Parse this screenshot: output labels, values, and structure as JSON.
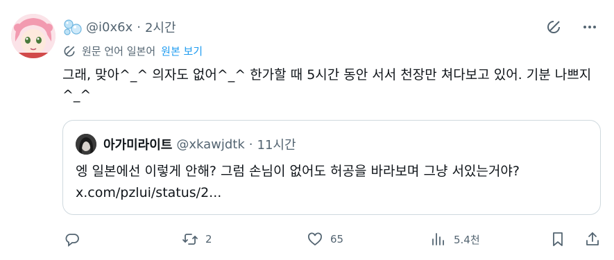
{
  "tweet": {
    "handle": "@i0x6x",
    "separator": "·",
    "time": "2시간",
    "translation_note": "원문 언어 일본어",
    "show_original": "원본 보기",
    "text": "그래, 맞아^_^ 의자도 없어^_^ 한가할 때 5시간 동안 서서 천장만 쳐다보고 있어. 기분 나쁘지^_^"
  },
  "quote": {
    "name": "아가미라이트",
    "handle": "@xkawjdtk",
    "separator": "·",
    "time": "11시간",
    "text_line1": "엥 일본에선 이렇게 안해? 그럼 손님이 없어도 허공을 바라보며 그냥 서있는거야?",
    "text_line2": "x.com/pzlui/status/2..."
  },
  "actions": {
    "reply_count": "",
    "retweet_count": "2",
    "like_count": "65",
    "views_count": "5.4천"
  },
  "icons": {
    "top": [
      "grok-icon",
      "more-icon"
    ],
    "bar": [
      "reply-icon",
      "retweet-icon",
      "like-icon",
      "views-icon",
      "bookmark-icon",
      "share-icon"
    ]
  },
  "colors": {
    "text": "#0f1419",
    "secondary": "#536471",
    "link": "#1d9bf0",
    "border": "#cfd9de"
  }
}
